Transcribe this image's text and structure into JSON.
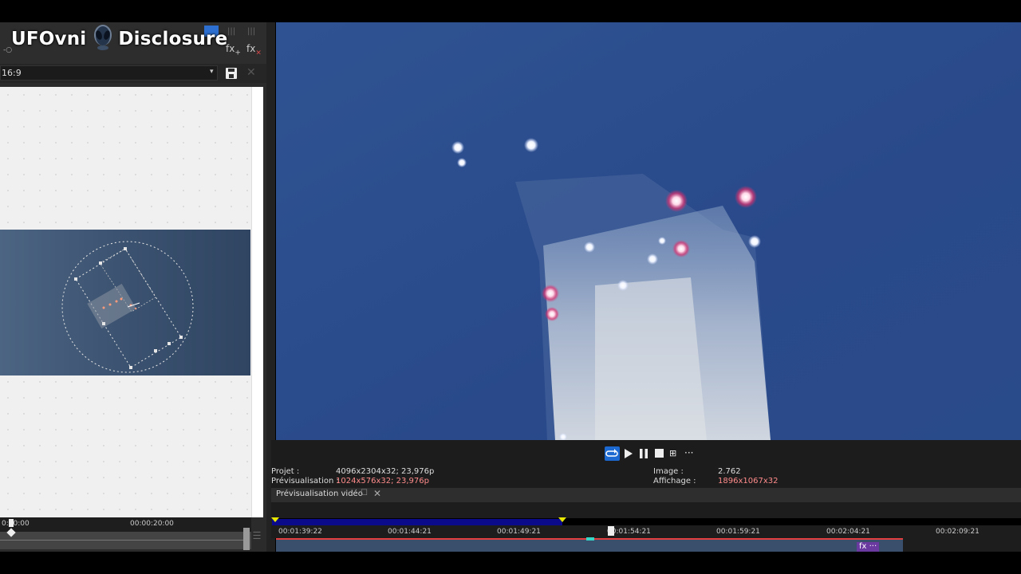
{
  "watermark": {
    "text": "UFOvni",
    "text2": "Disclosure"
  },
  "left_panel": {
    "fx_add_label": "fx",
    "fx_add_sub": "+",
    "fx_delete_label": "fx",
    "fx_delete_sub": "×",
    "small_tick": "-○",
    "aspect_ratio": "16:9",
    "ruler": {
      "labels": [
        "0:10:00",
        "00:00:20:00"
      ]
    }
  },
  "preview": {
    "transport": {
      "more": "···"
    },
    "info": {
      "project_label": "Projet :",
      "project_value": "4096x2304x32; 23,976p",
      "preview_label": "Prévisualisation :",
      "preview_value": "1024x576x32; 23,976p",
      "image_label": "Image :",
      "image_value": "2.762",
      "display_label": "Affichage :",
      "display_value": "1896x1067x32"
    },
    "tab": {
      "label": "Prévisualisation vidéo"
    }
  },
  "timeline": {
    "labels": [
      "00:01:39:22",
      "00:01:44:21",
      "00:01:49:21",
      "00:01:54:21",
      "00:01:59:21",
      "00:02:04:21",
      "00:02:09:21"
    ],
    "fx_badge": "fx ···"
  },
  "colors": {
    "accent": "#1c6ad1",
    "loop_region": "#0a0a8a",
    "loop_marker": "#e8e800",
    "sky": "#2a4a86"
  }
}
